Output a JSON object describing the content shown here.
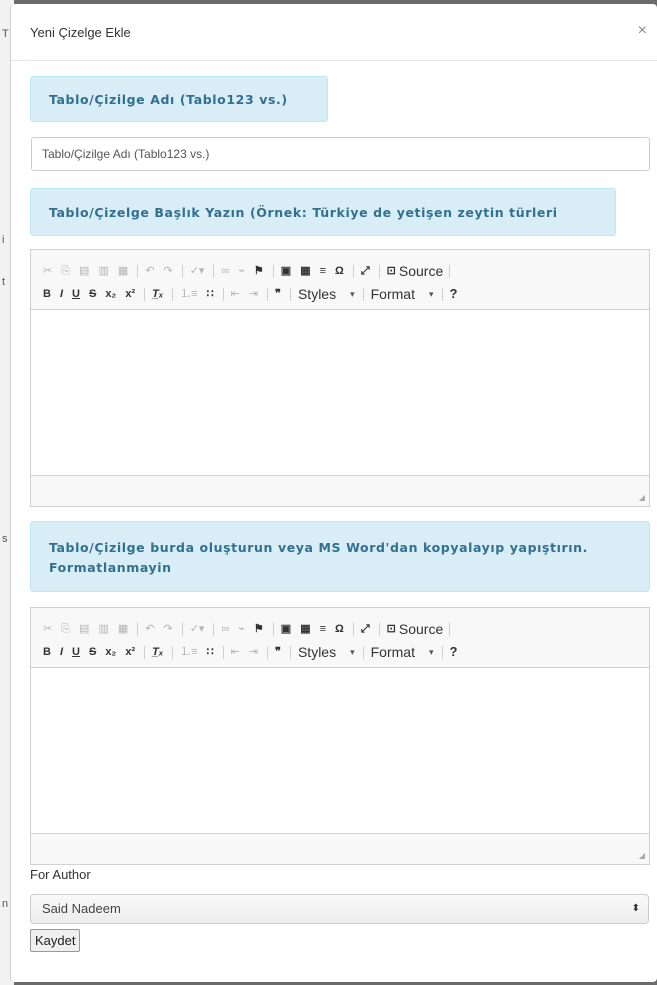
{
  "modal": {
    "title": "Yeni Çizelge Ekle",
    "close_icon": "×"
  },
  "sections": {
    "table_name_label": "Tablo/Çizilge Adı (Tablo123 vs.)",
    "table_name_placeholder": "Tablo/Çizilge Adı (Tablo123 vs.)",
    "title_label": "Tablo/Çizelge Başlık Yazın (Örnek: Türkiye de yetişen zeytin türleri",
    "content_label_line1": "Tablo/Çizilge burda oluşturun veya MS Word'dan kopyalayıp yapıştırın.",
    "content_label_line2": "Formatlanmayin"
  },
  "editor": {
    "source_label": "Source",
    "styles_label": "Styles",
    "format_label": "Format",
    "help_label": "?",
    "bold": "B",
    "italic": "I",
    "underline": "U",
    "strike": "S"
  },
  "author": {
    "label": "For Author",
    "selected": "Said Nadeem"
  },
  "save_label": "Kaydet",
  "background_letters": [
    "T",
    "i",
    "t",
    "s",
    "n"
  ],
  "colors": {
    "info_bg": "#d9edf7",
    "info_text": "#31708f",
    "overlay": "#6b6b6b"
  }
}
